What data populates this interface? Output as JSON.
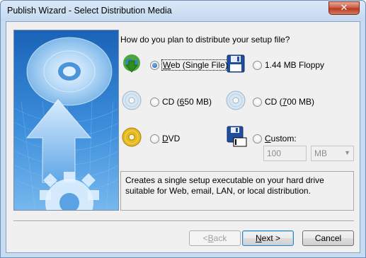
{
  "window": {
    "title": "Publish Wizard - Select Distribution Media",
    "close_glyph": "✕"
  },
  "question": "How do you plan to distribute your setup file?",
  "options": {
    "web": {
      "pre": "",
      "accel": "W",
      "post": "eb (Single File)",
      "selected": true,
      "icon": "globe-download-icon"
    },
    "floppy": {
      "text": "1.44 MB Floppy",
      "selected": false,
      "icon": "floppy-disk-icon"
    },
    "cd650": {
      "pre": "CD (",
      "accel": "6",
      "post": "50 MB)",
      "selected": false,
      "icon": "cd-icon"
    },
    "cd700": {
      "pre": "CD (",
      "accel": "7",
      "post": "00 MB)",
      "selected": false,
      "icon": "cd-icon"
    },
    "dvd": {
      "pre": "",
      "accel": "D",
      "post": "VD",
      "selected": false,
      "icon": "dvd-icon"
    },
    "custom": {
      "pre": "",
      "accel": "C",
      "post": "ustom:",
      "selected": false,
      "icon": "custom-floppy-icon"
    }
  },
  "custom_size": {
    "value": "100",
    "unit": "MB",
    "arrow": "▼"
  },
  "description": "Creates a single setup executable on your hard drive suitable for Web, email, LAN, or local distribution.",
  "buttons": {
    "back": {
      "pre": "< ",
      "accel": "B",
      "post": "ack"
    },
    "next": {
      "accel": "N",
      "post": "ext >"
    },
    "cancel": "Cancel"
  },
  "colors": {
    "banner_blue": "#1d6fc4",
    "banner_light": "#8cc8f5"
  }
}
